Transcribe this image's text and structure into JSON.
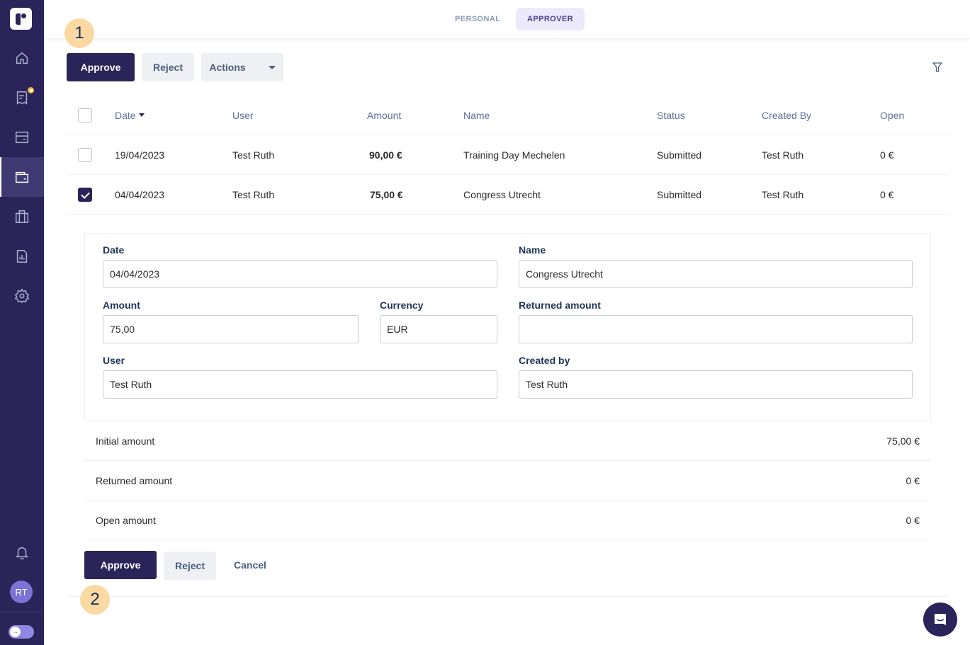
{
  "sidebar": {
    "items": [
      {
        "name": "home",
        "icon": "home-icon"
      },
      {
        "name": "expenses",
        "icon": "receipt-icon",
        "badge": true
      },
      {
        "name": "cards",
        "icon": "card-icon"
      },
      {
        "name": "wallet",
        "icon": "wallet-icon",
        "active": true
      },
      {
        "name": "trips",
        "icon": "suitcase-icon"
      },
      {
        "name": "reports",
        "icon": "report-icon"
      },
      {
        "name": "settings",
        "icon": "gear-icon"
      }
    ],
    "avatar_initials": "RT",
    "notifications_icon": "bell-icon",
    "toggle_icon": "arrow-right-icon"
  },
  "tabs": [
    {
      "label": "PERSONAL",
      "active": false
    },
    {
      "label": "APPROVER",
      "active": true
    }
  ],
  "steps": [
    "1",
    "2"
  ],
  "toolbar": {
    "approve_label": "Approve",
    "reject_label": "Reject",
    "actions_label": "Actions"
  },
  "table": {
    "columns": [
      "Date",
      "User",
      "Amount",
      "Name",
      "Status",
      "Created By",
      "Open"
    ],
    "rows": [
      {
        "checked": false,
        "date": "19/04/2023",
        "user": "Test Ruth",
        "amount": "90,00 €",
        "name": "Training Day Mechelen",
        "status": "Submitted",
        "created_by": "Test Ruth",
        "open": "0 €"
      },
      {
        "checked": true,
        "date": "04/04/2023",
        "user": "Test Ruth",
        "amount": "75,00 €",
        "name": "Congress Utrecht",
        "status": "Submitted",
        "created_by": "Test Ruth",
        "open": "0 €"
      }
    ]
  },
  "detail": {
    "fields": {
      "date": {
        "label": "Date",
        "value": "04/04/2023"
      },
      "name": {
        "label": "Name",
        "value": "Congress Utrecht"
      },
      "amount": {
        "label": "Amount",
        "value": "75,00"
      },
      "currency": {
        "label": "Currency",
        "value": "EUR"
      },
      "returned_amount": {
        "label": "Returned amount",
        "value": ""
      },
      "user": {
        "label": "User",
        "value": "Test Ruth"
      },
      "created_by": {
        "label": "Created by",
        "value": "Test Ruth"
      }
    },
    "summary": [
      {
        "label": "Initial amount",
        "value": "75,00 €"
      },
      {
        "label": "Returned amount",
        "value": "0 €"
      },
      {
        "label": "Open amount",
        "value": "0 €"
      }
    ],
    "approve_label": "Approve",
    "reject_label": "Reject",
    "cancel_label": "Cancel"
  },
  "colors": {
    "brand": "#2b2459",
    "accent_badge": "#f5b63f",
    "step_marker": "#fcd9a2"
  }
}
